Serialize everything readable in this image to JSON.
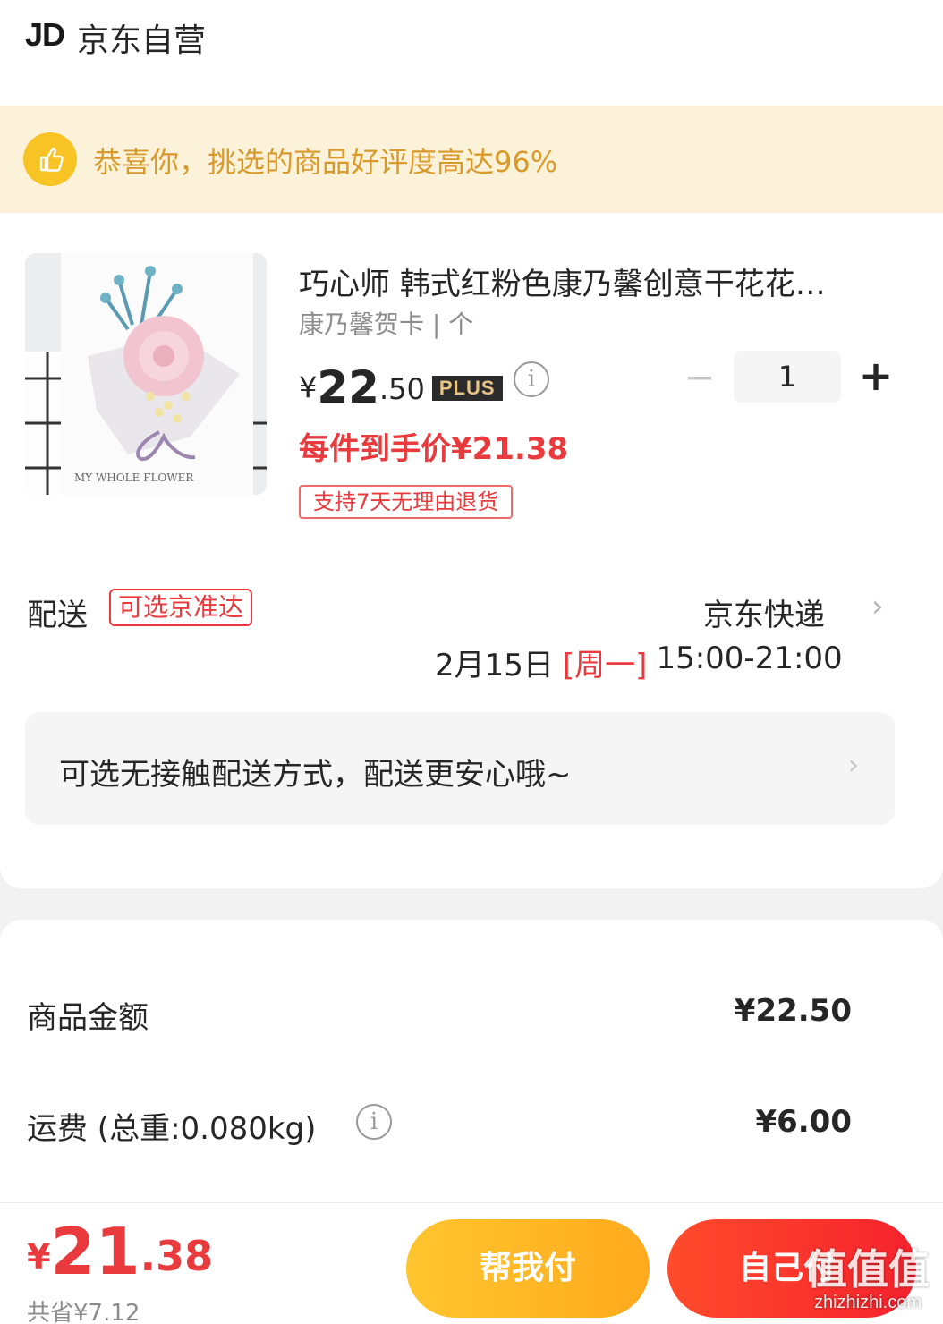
{
  "header": {
    "logo_text": "JD",
    "shop_name": "京东自营"
  },
  "banner": {
    "icon": "thumbs-up-icon",
    "text": "恭喜你，挑选的商品好评度高达96%",
    "accent_color": "#f7c325"
  },
  "product": {
    "title": "巧心师 韩式红粉色康乃馨创意干花花…",
    "spec": "康乃馨贺卡 | 个",
    "price": {
      "currency": "¥",
      "integer": "22",
      "decimal": ".50",
      "member_badge": "PLUS"
    },
    "final_price": "每件到手价¥21.38",
    "return_tag": "支持7天无理由退货",
    "quantity": {
      "minus": "−",
      "value": "1",
      "plus": "+"
    },
    "image_caption": "MY WHOLE FLOWER"
  },
  "shipping": {
    "label": "配送",
    "tag": "可选京准达",
    "carrier": "京东快递",
    "date": "2月15日",
    "day": "[周一]",
    "time_range": "15:00-21:00",
    "contactless_text": "可选无接触配送方式，配送更安心哦~"
  },
  "summary": {
    "goods_label": "商品金额",
    "goods_value": "¥22.50",
    "freight_label": "运费 (总重:0.080kg)",
    "freight_value": "¥6.00"
  },
  "footer": {
    "total_currency": "¥",
    "total_integer": "21",
    "total_decimal": ".38",
    "saved": "共省¥7.12",
    "btn_help": "帮我付",
    "btn_self": "自己付",
    "watermark_glyph": "值值值",
    "watermark_url": "zhizhizhi.com"
  },
  "colors": {
    "price_red": "#e93b3d",
    "banner_bg": "#fcf1d9",
    "banner_text": "#d89a2a",
    "btn_help": "#ffb625",
    "btn_self": "#f5222d"
  }
}
